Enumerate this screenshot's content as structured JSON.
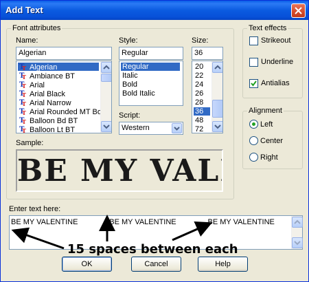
{
  "window": {
    "title": "Add Text"
  },
  "font_attributes": {
    "legend": "Font attributes",
    "name_label": "Name:",
    "name_value": "Algerian",
    "fonts": [
      "Algerian",
      "Ambiance BT",
      "Arial",
      "Arial Black",
      "Arial Narrow",
      "Arial Rounded MT Bo",
      "Balloon Bd BT",
      "Balloon Lt BT"
    ],
    "selected_font_index": 0,
    "style_label": "Style:",
    "style_value": "Regular",
    "styles": [
      "Regular",
      "Italic",
      "Bold",
      "Bold Italic"
    ],
    "selected_style_index": 0,
    "size_label": "Size:",
    "size_value": "36",
    "sizes": [
      "20",
      "22",
      "24",
      "26",
      "28",
      "36",
      "48",
      "72"
    ],
    "selected_size_index": 5,
    "script_label": "Script:",
    "script_value": "Western",
    "sample_label": "Sample:",
    "sample_text": "BE MY VALEN"
  },
  "text_effects": {
    "legend": "Text effects",
    "items": [
      {
        "label": "Strikeout",
        "checked": false
      },
      {
        "label": "Underline",
        "checked": false
      },
      {
        "label": "Antialias",
        "checked": true
      }
    ]
  },
  "alignment": {
    "legend": "Alignment",
    "options": [
      {
        "label": "Left",
        "selected": true
      },
      {
        "label": "Center",
        "selected": false
      },
      {
        "label": "Right",
        "selected": false
      }
    ]
  },
  "entry": {
    "label": "Enter text here:",
    "text": "BE MY VALENTINE               BE MY VALENTINE               BE MY VALENTINE"
  },
  "annotation": {
    "text": "15 spaces between each"
  },
  "buttons": {
    "ok": "OK",
    "cancel": "Cancel",
    "help": "Help"
  },
  "colors": {
    "title_bar": "#0a5fe8",
    "selection": "#316ac5",
    "dialog_bg": "#ece9d8",
    "check_green": "#21a121"
  }
}
